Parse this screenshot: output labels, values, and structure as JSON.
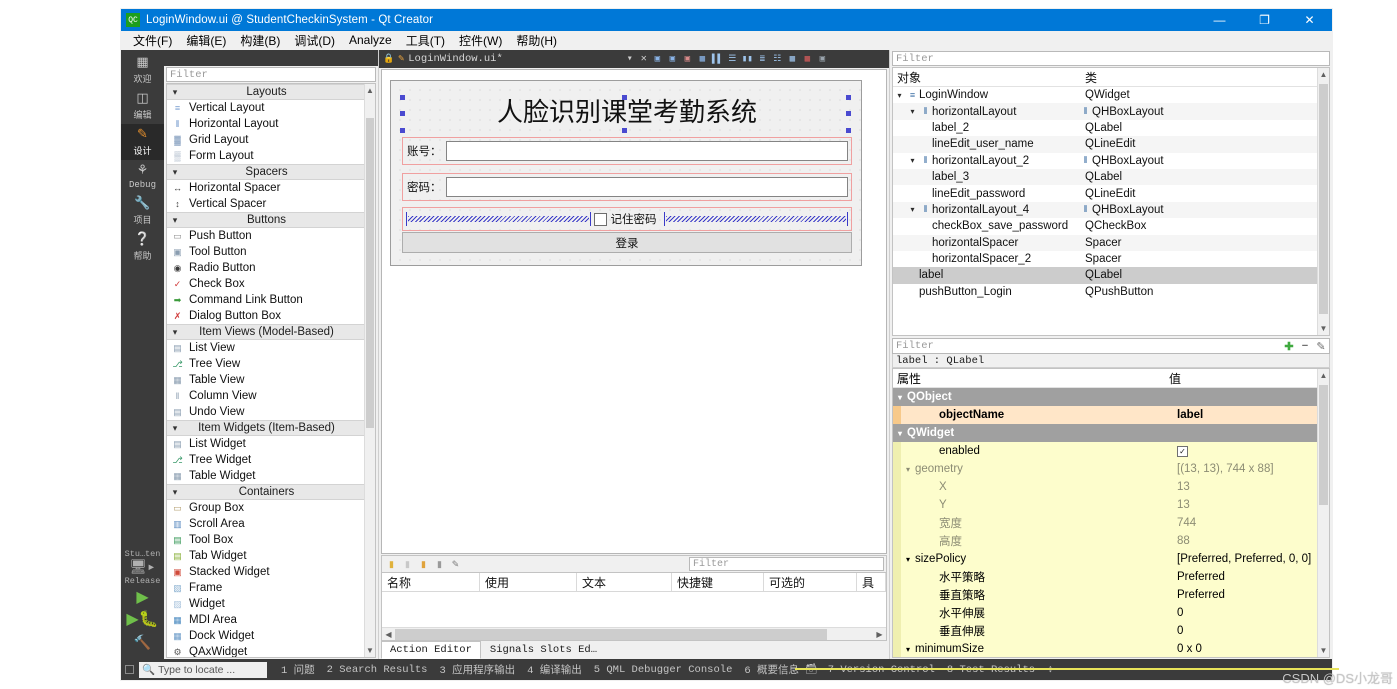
{
  "window": {
    "app_icon": "qt-creator-icon",
    "title": "LoginWindow.ui @ StudentCheckinSystem - Qt Creator",
    "minimize": "—",
    "maximize": "❐",
    "close": "✕"
  },
  "menubar": {
    "items": [
      {
        "label": "文件(F)"
      },
      {
        "label": "编辑(E)"
      },
      {
        "label": "构建(B)"
      },
      {
        "label": "调试(D)"
      },
      {
        "label": "Analyze"
      },
      {
        "label": "工具(T)"
      },
      {
        "label": "控件(W)"
      },
      {
        "label": "帮助(H)"
      }
    ]
  },
  "rail": {
    "modes": [
      {
        "label": "欢迎",
        "icon": "grid-icon",
        "glyph": "▒",
        "active": false
      },
      {
        "label": "编辑",
        "icon": "document-icon",
        "glyph": "☰",
        "active": false
      },
      {
        "label": "设计",
        "icon": "pencil-icon",
        "glyph": "✎",
        "active": true
      },
      {
        "label": "Debug",
        "icon": "bug-icon",
        "glyph": "⛭",
        "active": false
      },
      {
        "label": "项目",
        "icon": "wrench-icon",
        "glyph": "ᴧ",
        "active": false
      },
      {
        "label": "帮助",
        "icon": "help-icon",
        "glyph": "?",
        "active": false
      }
    ],
    "kit_label": "Stu…ten",
    "build_label": "Release",
    "run_icon": "run-triangle-icon",
    "debug_icon": "debug-run-icon",
    "build_icon": "hammer-icon"
  },
  "widget_box": {
    "filter_placeholder": "Filter",
    "categories": [
      {
        "name": "Layouts",
        "items": [
          {
            "label": "Vertical Layout",
            "icon": "vertical-layout-icon"
          },
          {
            "label": "Horizontal Layout",
            "icon": "horizontal-layout-icon"
          },
          {
            "label": "Grid Layout",
            "icon": "grid-layout-icon"
          },
          {
            "label": "Form Layout",
            "icon": "form-layout-icon"
          }
        ]
      },
      {
        "name": "Spacers",
        "items": [
          {
            "label": "Horizontal Spacer",
            "icon": "horizontal-spacer-icon"
          },
          {
            "label": "Vertical Spacer",
            "icon": "vertical-spacer-icon"
          }
        ]
      },
      {
        "name": "Buttons",
        "items": [
          {
            "label": "Push Button",
            "icon": "push-button-icon"
          },
          {
            "label": "Tool Button",
            "icon": "tool-button-icon"
          },
          {
            "label": "Radio Button",
            "icon": "radio-button-icon"
          },
          {
            "label": "Check Box",
            "icon": "check-box-icon"
          },
          {
            "label": "Command Link Button",
            "icon": "command-link-icon"
          },
          {
            "label": "Dialog Button Box",
            "icon": "dialog-button-box-icon"
          }
        ]
      },
      {
        "name": "Item Views (Model-Based)",
        "items": [
          {
            "label": "List View",
            "icon": "list-view-icon"
          },
          {
            "label": "Tree View",
            "icon": "tree-view-icon"
          },
          {
            "label": "Table View",
            "icon": "table-view-icon"
          },
          {
            "label": "Column View",
            "icon": "column-view-icon"
          },
          {
            "label": "Undo View",
            "icon": "undo-view-icon"
          }
        ]
      },
      {
        "name": "Item Widgets (Item-Based)",
        "items": [
          {
            "label": "List Widget",
            "icon": "list-widget-icon"
          },
          {
            "label": "Tree Widget",
            "icon": "tree-widget-icon"
          },
          {
            "label": "Table Widget",
            "icon": "table-widget-icon"
          }
        ]
      },
      {
        "name": "Containers",
        "items": [
          {
            "label": "Group Box",
            "icon": "group-box-icon"
          },
          {
            "label": "Scroll Area",
            "icon": "scroll-area-icon"
          },
          {
            "label": "Tool Box",
            "icon": "tool-box-icon"
          },
          {
            "label": "Tab Widget",
            "icon": "tab-widget-icon"
          },
          {
            "label": "Stacked Widget",
            "icon": "stacked-widget-icon"
          },
          {
            "label": "Frame",
            "icon": "frame-icon"
          },
          {
            "label": "Widget",
            "icon": "widget-icon"
          },
          {
            "label": "MDI Area",
            "icon": "mdi-area-icon"
          },
          {
            "label": "Dock Widget",
            "icon": "dock-widget-icon"
          },
          {
            "label": "QAxWidget",
            "icon": "qax-widget-icon"
          }
        ]
      }
    ]
  },
  "editor_tab": {
    "lock_icon": "lock-icon",
    "file_icon": "file-edit-icon",
    "filename": "LoginWindow.ui*",
    "dropdown": "▾",
    "close": "✕",
    "designer_tools": [
      "edit-widgets-icon",
      "edit-signals-icon",
      "edit-buddies-icon",
      "edit-tab-order-icon",
      "layout-horizontal-icon",
      "layout-vertical-icon",
      "layout-splitter-h-icon",
      "layout-splitter-v-icon",
      "layout-form-icon",
      "layout-grid-icon",
      "break-layout-icon",
      "adjust-size-icon"
    ]
  },
  "form_preview": {
    "title": "人脸识别课堂考勤系统",
    "account_label": "账号：",
    "account_value": "",
    "password_label": "密码：",
    "password_value": "",
    "remember_label": "记住密码",
    "remember_checked": false,
    "login_button": "登录"
  },
  "action_editor": {
    "filter_placeholder": "Filter",
    "toolbar_icons": [
      "new-action-icon",
      "copy-action-icon",
      "edit-action-icon",
      "delete-action-icon",
      "configure-icon"
    ],
    "columns": [
      "名称",
      "使用",
      "文本",
      "快捷键",
      "可选的",
      "工具提"
    ],
    "rows": [],
    "tabs": [
      {
        "label": "Action Editor",
        "active": true
      },
      {
        "label": "Signals  Slots Ed…",
        "active": false
      }
    ]
  },
  "object_inspector": {
    "filter_placeholder": "Filter",
    "columns": [
      "对象",
      "类"
    ],
    "rows": [
      {
        "name": "LoginWindow",
        "class": "QWidget",
        "indent": 0,
        "expandable": true,
        "icon": "widget-icon",
        "selected": false
      },
      {
        "name": "horizontalLayout",
        "class": "QHBoxLayout",
        "indent": 1,
        "expandable": true,
        "icon": "hbox-layout-icon",
        "class_icon": "hbox-layout-icon",
        "selected": false
      },
      {
        "name": "label_2",
        "class": "QLabel",
        "indent": 2,
        "expandable": false,
        "selected": false
      },
      {
        "name": "lineEdit_user_name",
        "class": "QLineEdit",
        "indent": 2,
        "expandable": false,
        "selected": false
      },
      {
        "name": "horizontalLayout_2",
        "class": "QHBoxLayout",
        "indent": 1,
        "expandable": true,
        "icon": "hbox-layout-icon",
        "class_icon": "hbox-layout-icon",
        "selected": false
      },
      {
        "name": "label_3",
        "class": "QLabel",
        "indent": 2,
        "expandable": false,
        "selected": false
      },
      {
        "name": "lineEdit_password",
        "class": "QLineEdit",
        "indent": 2,
        "expandable": false,
        "selected": false
      },
      {
        "name": "horizontalLayout_4",
        "class": "QHBoxLayout",
        "indent": 1,
        "expandable": true,
        "icon": "hbox-layout-icon",
        "class_icon": "hbox-layout-icon",
        "selected": false
      },
      {
        "name": "checkBox_save_password",
        "class": "QCheckBox",
        "indent": 2,
        "expandable": false,
        "selected": false
      },
      {
        "name": "horizontalSpacer",
        "class": "Spacer",
        "indent": 2,
        "expandable": false,
        "selected": false
      },
      {
        "name": "horizontalSpacer_2",
        "class": "Spacer",
        "indent": 2,
        "expandable": false,
        "selected": false
      },
      {
        "name": "label",
        "class": "QLabel",
        "indent": 1,
        "expandable": false,
        "selected": true
      },
      {
        "name": "pushButton_Login",
        "class": "QPushButton",
        "indent": 1,
        "expandable": false,
        "selected": false
      }
    ]
  },
  "property_editor": {
    "filter_placeholder": "Filter",
    "add_icon": "plus-icon",
    "remove_icon": "minus-icon",
    "configure_icon": "configure-icon",
    "object_line": "label : QLabel",
    "columns": [
      "属性",
      "值"
    ],
    "rows": [
      {
        "key": "QObject",
        "value": "",
        "style": "group",
        "indent": 0,
        "expandable": true
      },
      {
        "key": "objectName",
        "value": "label",
        "style": "hl",
        "indent": 1,
        "expandable": false
      },
      {
        "key": "QWidget",
        "value": "",
        "style": "group",
        "indent": 0,
        "expandable": true
      },
      {
        "key": "enabled",
        "value": "",
        "style": "y",
        "indent": 1,
        "expandable": false,
        "checkbox": true,
        "checked": true
      },
      {
        "key": "geometry",
        "value": "[(13, 13), 744 x 88]",
        "style": "y2",
        "indent": 0,
        "expandable": true
      },
      {
        "key": "X",
        "value": "13",
        "style": "y2",
        "indent": 1,
        "expandable": false
      },
      {
        "key": "Y",
        "value": "13",
        "style": "y2",
        "indent": 1,
        "expandable": false
      },
      {
        "key": "宽度",
        "value": "744",
        "style": "y2",
        "indent": 1,
        "expandable": false
      },
      {
        "key": "高度",
        "value": "88",
        "style": "y2",
        "indent": 1,
        "expandable": false
      },
      {
        "key": "sizePolicy",
        "value": "[Preferred, Preferred, 0, 0]",
        "style": "y",
        "indent": 0,
        "expandable": true
      },
      {
        "key": "水平策略",
        "value": "Preferred",
        "style": "y",
        "indent": 1,
        "expandable": false
      },
      {
        "key": "垂直策略",
        "value": "Preferred",
        "style": "y",
        "indent": 1,
        "expandable": false
      },
      {
        "key": "水平伸展",
        "value": "0",
        "style": "y",
        "indent": 1,
        "expandable": false
      },
      {
        "key": "垂直伸展",
        "value": "0",
        "style": "y",
        "indent": 1,
        "expandable": false
      },
      {
        "key": "minimumSize",
        "value": "0 x 0",
        "style": "y",
        "indent": 0,
        "expandable": true
      }
    ]
  },
  "statusbar": {
    "locator_placeholder": "Type to locate ...",
    "search_icon": "search-icon",
    "vcs_icon": "vcs-icon",
    "panes": [
      {
        "num": "1",
        "label": "问题"
      },
      {
        "num": "2",
        "label": "Search Results"
      },
      {
        "num": "3",
        "label": "应用程序输出"
      },
      {
        "num": "4",
        "label": "编译输出"
      },
      {
        "num": "5",
        "label": "QML Debugger Console"
      },
      {
        "num": "6",
        "label": "概要信息"
      },
      {
        "num": "7",
        "label": "Version Control"
      },
      {
        "num": "8",
        "label": "Test Results"
      }
    ],
    "resize_glyph": "↕"
  },
  "watermark": "CSDN @DS小龙哥",
  "colors": {
    "titlebar": "#0078d7",
    "rail": "#3b3b3b",
    "selection": "#cccccc",
    "property_group": "#a0a0a0",
    "property_highlight": "#ffe6c8",
    "property_yellow": "#fdfdcc",
    "spacer_blue": "#3a3ac8",
    "layout_red": "#f0a0a0"
  }
}
